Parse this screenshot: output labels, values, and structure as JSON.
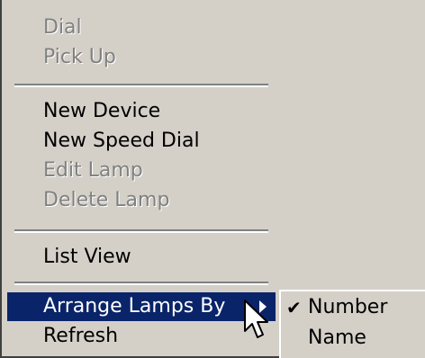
{
  "menu": {
    "items": [
      {
        "label": "Dial",
        "enabled": false
      },
      {
        "label": "Pick Up",
        "enabled": false
      },
      {
        "label": "New Device",
        "enabled": true
      },
      {
        "label": "New Speed Dial",
        "enabled": true
      },
      {
        "label": "Edit Lamp",
        "enabled": false
      },
      {
        "label": "Delete Lamp",
        "enabled": false
      },
      {
        "label": "List View",
        "enabled": true
      },
      {
        "label": "Arrange Lamps By",
        "enabled": true,
        "highlighted": true,
        "has_submenu": true
      },
      {
        "label": "Refresh",
        "enabled": true
      }
    ]
  },
  "submenu": {
    "items": [
      {
        "label": "Number",
        "checked": true
      },
      {
        "label": "Name",
        "checked": false
      }
    ],
    "check_glyph": "✔"
  },
  "colors": {
    "menu_bg": "#d4d0c8",
    "highlight_bg": "#0a246a",
    "disabled_text": "#808080"
  },
  "icons": {
    "submenu_arrow": "chevron-right-icon",
    "cursor": "mouse-pointer-icon",
    "check": "check-icon"
  }
}
